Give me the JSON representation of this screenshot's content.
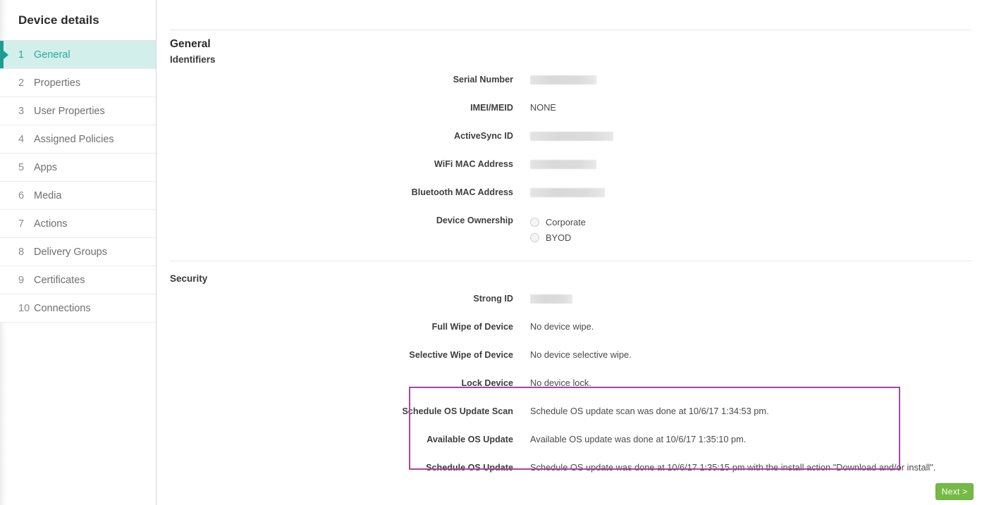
{
  "sidebar": {
    "title": "Device details",
    "items": [
      {
        "num": "1",
        "label": "General",
        "active": true
      },
      {
        "num": "2",
        "label": "Properties",
        "active": false
      },
      {
        "num": "3",
        "label": "User Properties",
        "active": false
      },
      {
        "num": "4",
        "label": "Assigned Policies",
        "active": false
      },
      {
        "num": "5",
        "label": "Apps",
        "active": false
      },
      {
        "num": "6",
        "label": "Media",
        "active": false
      },
      {
        "num": "7",
        "label": "Actions",
        "active": false
      },
      {
        "num": "8",
        "label": "Delivery Groups",
        "active": false
      },
      {
        "num": "9",
        "label": "Certificates",
        "active": false
      },
      {
        "num": "10",
        "label": "Connections",
        "active": false
      }
    ]
  },
  "main": {
    "page_title": "General",
    "identifiers": {
      "heading": "Identifiers",
      "rows": [
        {
          "label": "Serial Number",
          "value": "",
          "redacted": true,
          "redact_width": 94
        },
        {
          "label": "IMEI/MEID",
          "value": "NONE",
          "redacted": false
        },
        {
          "label": "ActiveSync ID",
          "value": "",
          "redacted": true,
          "redact_width": 118
        },
        {
          "label": "WiFi MAC Address",
          "value": "",
          "redacted": true,
          "redact_width": 94
        },
        {
          "label": "Bluetooth MAC Address",
          "value": "",
          "redacted": true,
          "redact_width": 106
        }
      ],
      "ownership": {
        "label": "Device Ownership",
        "options": [
          {
            "label": "Corporate",
            "selected": false
          },
          {
            "label": "BYOD",
            "selected": false
          }
        ]
      }
    },
    "security": {
      "heading": "Security",
      "rows": [
        {
          "label": "Strong ID",
          "value": "",
          "redacted": true,
          "redact_width": 60
        },
        {
          "label": "Full Wipe of Device",
          "value": "No device wipe.",
          "redacted": false
        },
        {
          "label": "Selective Wipe of Device",
          "value": "No device selective wipe.",
          "redacted": false
        },
        {
          "label": "Lock Device",
          "value": "No device lock.",
          "redacted": false
        }
      ],
      "highlighted_rows": [
        {
          "label": "Schedule OS Update Scan",
          "value": "Schedule OS update scan was done at 10/6/17 1:34:53 pm."
        },
        {
          "label": "Available OS Update",
          "value": "Available OS update was done at 10/6/17 1:35:10 pm."
        },
        {
          "label": "Schedule OS Update",
          "value": "Schedule OS update was done at 10/6/17 1:35:15 pm with the install action \"Download and/or install\"."
        }
      ]
    }
  },
  "footer": {
    "next_label": "Next >"
  },
  "colors": {
    "accent_teal": "#2aa99a",
    "sidebar_active_bg": "#d3efeb",
    "highlight_border": "#a348a1",
    "next_button": "#76ba45"
  }
}
